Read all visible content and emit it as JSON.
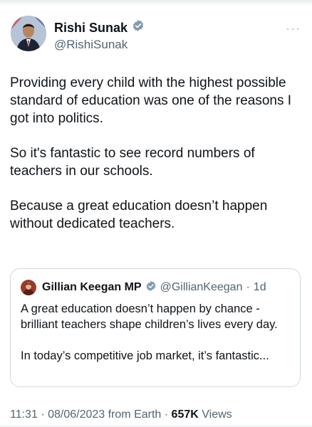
{
  "author": {
    "name": "Rishi Sunak",
    "handle": "@RishiSunak",
    "verified_color": "#829aab"
  },
  "more_label": "···",
  "tweet": {
    "paragraphs": [
      "Providing every child with the highest possible standard of education was one of the reasons I got into politics.",
      "So it's fantastic to see record numbers of teachers in our schools.",
      "Because a great education doesn’t happen without dedicated teachers."
    ]
  },
  "quoted": {
    "name": "Gillian Keegan MP",
    "handle": "@GillianKeegan",
    "separator": "·",
    "time": "1d",
    "paragraphs": [
      "A great education doesn’t happen by chance - brilliant teachers shape children’s lives every day.",
      "In today’s competitive job market, it’s fantastic..."
    ]
  },
  "meta": {
    "time": "11:31",
    "sep1": "·",
    "date": "08/06/2023",
    "source": "from Earth",
    "sep2": "·",
    "views_count": "657K",
    "views_label": "Views"
  },
  "colors": {
    "text": "#0f1419",
    "secondary": "#536471",
    "border": "#cfd9de"
  }
}
